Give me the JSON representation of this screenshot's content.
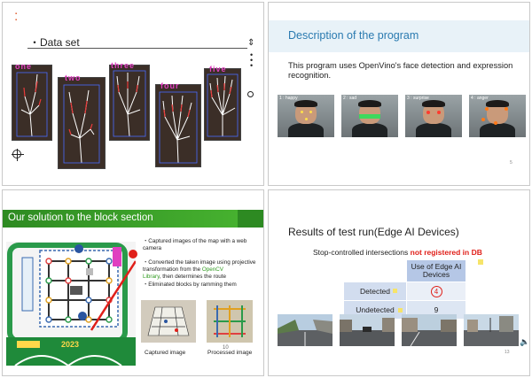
{
  "slide1": {
    "title": "・Data set",
    "hand_labels": [
      "one",
      "two",
      "three",
      "four",
      "five"
    ],
    "toolbar_icons": [
      "move-icon",
      "more-icon",
      "close-icon"
    ],
    "bottom_icon": "crosshair-icon"
  },
  "slide2": {
    "title": "Description of the program",
    "body": "This program uses OpenVino's face detection and expression recognition.",
    "faces": [
      {
        "label": "1 : happy"
      },
      {
        "label": "2 : sad"
      },
      {
        "label": "3 : surprise"
      },
      {
        "label": "4 : anger"
      }
    ],
    "page_number": "5"
  },
  "slide3": {
    "title": "Our solution to the block section",
    "bullets": [
      "・Captured images of the map with a web camera",
      "・Converted the taken image using projective transformation from the ",
      "Library, then determines the route",
      "・Eliminated blocks by ramming them"
    ],
    "opencv_text": "OpenCV",
    "map_year": "2023",
    "caption_left": "Captured image",
    "caption_right": "Processed image",
    "page_number": "10"
  },
  "slide4": {
    "title": "Results of test run(Edge AI Devices)",
    "subtitle_normal": "Stop-controlled intersections ",
    "subtitle_red": "not registered in DB",
    "table": {
      "header": "Use of Edge AI Devices",
      "rows": [
        {
          "label": "Detected",
          "value": "4"
        },
        {
          "label": "Undetected",
          "value": "9"
        }
      ]
    },
    "page_number": "13"
  },
  "colors": {
    "green_bar": "#46b12f",
    "table_header": "#b5c7e6",
    "table_row_label": "#d2ddef",
    "red": "#e0201a",
    "label_pink": "#e040c0"
  }
}
